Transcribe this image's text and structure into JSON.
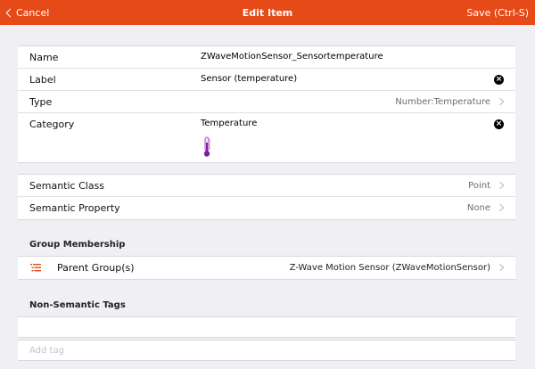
{
  "navbar": {
    "back_label": "Cancel",
    "title": "Edit Item",
    "save_label": "Save (Ctrl-S)"
  },
  "item": {
    "name_label": "Name",
    "name_value": "ZWaveMotionSensor_Sensortemperature",
    "label_label": "Label",
    "label_value": "Sensor (temperature)",
    "type_label": "Type",
    "type_value": "Number:Temperature",
    "category_label": "Category",
    "category_value": "Temperature",
    "category_icon": "thermometer-icon"
  },
  "semantics": {
    "class_label": "Semantic Class",
    "class_value": "Point",
    "property_label": "Semantic Property",
    "property_value": "None"
  },
  "group_membership": {
    "title": "Group Membership",
    "parent_label": "Parent Group(s)",
    "parent_value": "Z-Wave Motion Sensor (ZWaveMotionSensor)",
    "icon": "list-icon"
  },
  "tags": {
    "title": "Non-Semantic Tags",
    "placeholder": "Add tag",
    "value": ""
  },
  "colors": {
    "accent": "#e64a19",
    "thermometer": "#7b1fa2"
  }
}
